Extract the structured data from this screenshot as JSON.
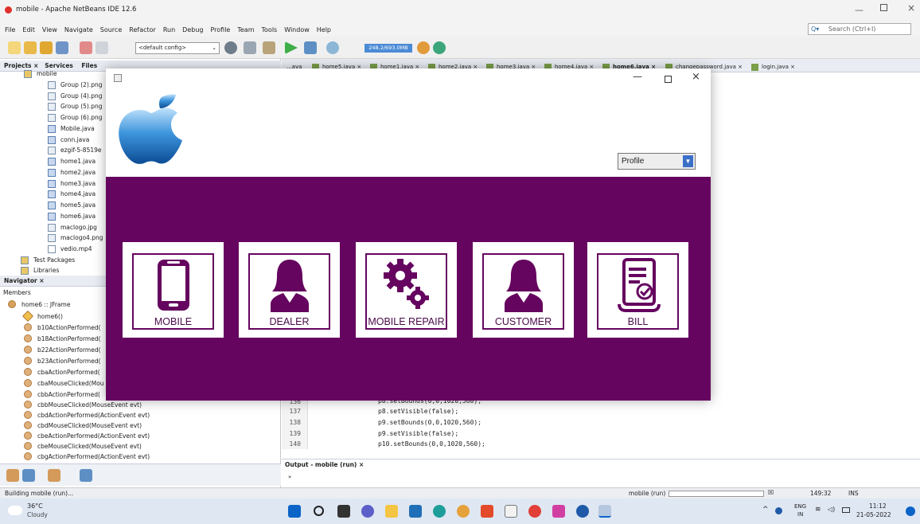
{
  "ide": {
    "title": "mobile - Apache NetBeans IDE 12.6",
    "menu": [
      "File",
      "Edit",
      "View",
      "Navigate",
      "Source",
      "Refactor",
      "Run",
      "Debug",
      "Profile",
      "Team",
      "Tools",
      "Window",
      "Help"
    ],
    "search_placeholder": "Search (Ctrl+I)",
    "config": "<default config>",
    "memory": "248.2/693.0MB",
    "panel_tabs": [
      "Projects",
      "Services",
      "Files"
    ],
    "editor_tabs": [
      "...ava",
      "home5.java",
      "home1.java",
      "home2.java",
      "home3.java",
      "home4.java",
      "home6.java",
      "changepassword.java",
      "login.java"
    ],
    "project_root": "mobile",
    "files": [
      "Group (2).png",
      "Group (4).png",
      "Group (5).png",
      "Group (6).png",
      "Mobile.java",
      "conn.java",
      "ezgif-5-8519e",
      "home1.java",
      "home2.java",
      "home3.java",
      "home4.java",
      "home5.java",
      "home6.java",
      "maclogo.jpg",
      "maclogo4.png",
      "vedio.mp4"
    ],
    "packages": [
      "Test Packages",
      "Libraries"
    ],
    "navigator_title": "Navigator",
    "members_label": "Members",
    "navigator_class": "home6 :: JFrame",
    "navigator_items": [
      "home6()",
      "b10ActionPerformed(",
      "b18ActionPerformed(",
      "b22ActionPerformed(",
      "b23ActionPerformed(",
      "cbaActionPerformed(",
      "cbaMouseClicked(Mou",
      "cbbActionPerformed(",
      "cbbMouseClicked(MouseEvent evt)",
      "cbdActionPerformed(ActionEvent evt)",
      "cbdMouseClicked(MouseEvent evt)",
      "cbeActionPerformed(ActionEvent evt)",
      "cbeMouseClicked(MouseEvent evt)",
      "cbgActionPerformed(ActionEvent evt)"
    ],
    "code_lines": [
      {
        "n": "136",
        "code": "p8.setBounds(0,0,1020,560);"
      },
      {
        "n": "137",
        "code": "p8.setVisible(false);"
      },
      {
        "n": "138",
        "code": "p9.setBounds(0,0,1020,560);"
      },
      {
        "n": "139",
        "code": "p9.setVisible(false);"
      },
      {
        "n": "140",
        "code": "p10.setBounds(0,0,1020,560);"
      }
    ],
    "output_title": "Output - mobile (run)",
    "status_left": "Building mobile (run)...",
    "status_run": "mobile (run)",
    "cursor_pos": "149:32",
    "ins_mode": "INS"
  },
  "taskbar": {
    "temp": "36°C",
    "weather": "Cloudy",
    "lang": "ENG",
    "lang2": "IN",
    "time": "11:12",
    "date": "21-05-2022"
  },
  "app": {
    "profile_value": "Profile",
    "cards": [
      {
        "label": "MOBILE",
        "icon": "mobile-phone-icon"
      },
      {
        "label": "DEALER",
        "icon": "person-icon"
      },
      {
        "label": "MOBILE REPAIR",
        "icon": "gears-icon"
      },
      {
        "label": "CUSTOMER",
        "icon": "person-icon"
      },
      {
        "label": "BILL",
        "icon": "receipt-icon"
      }
    ],
    "brand_color": "#65055f"
  }
}
